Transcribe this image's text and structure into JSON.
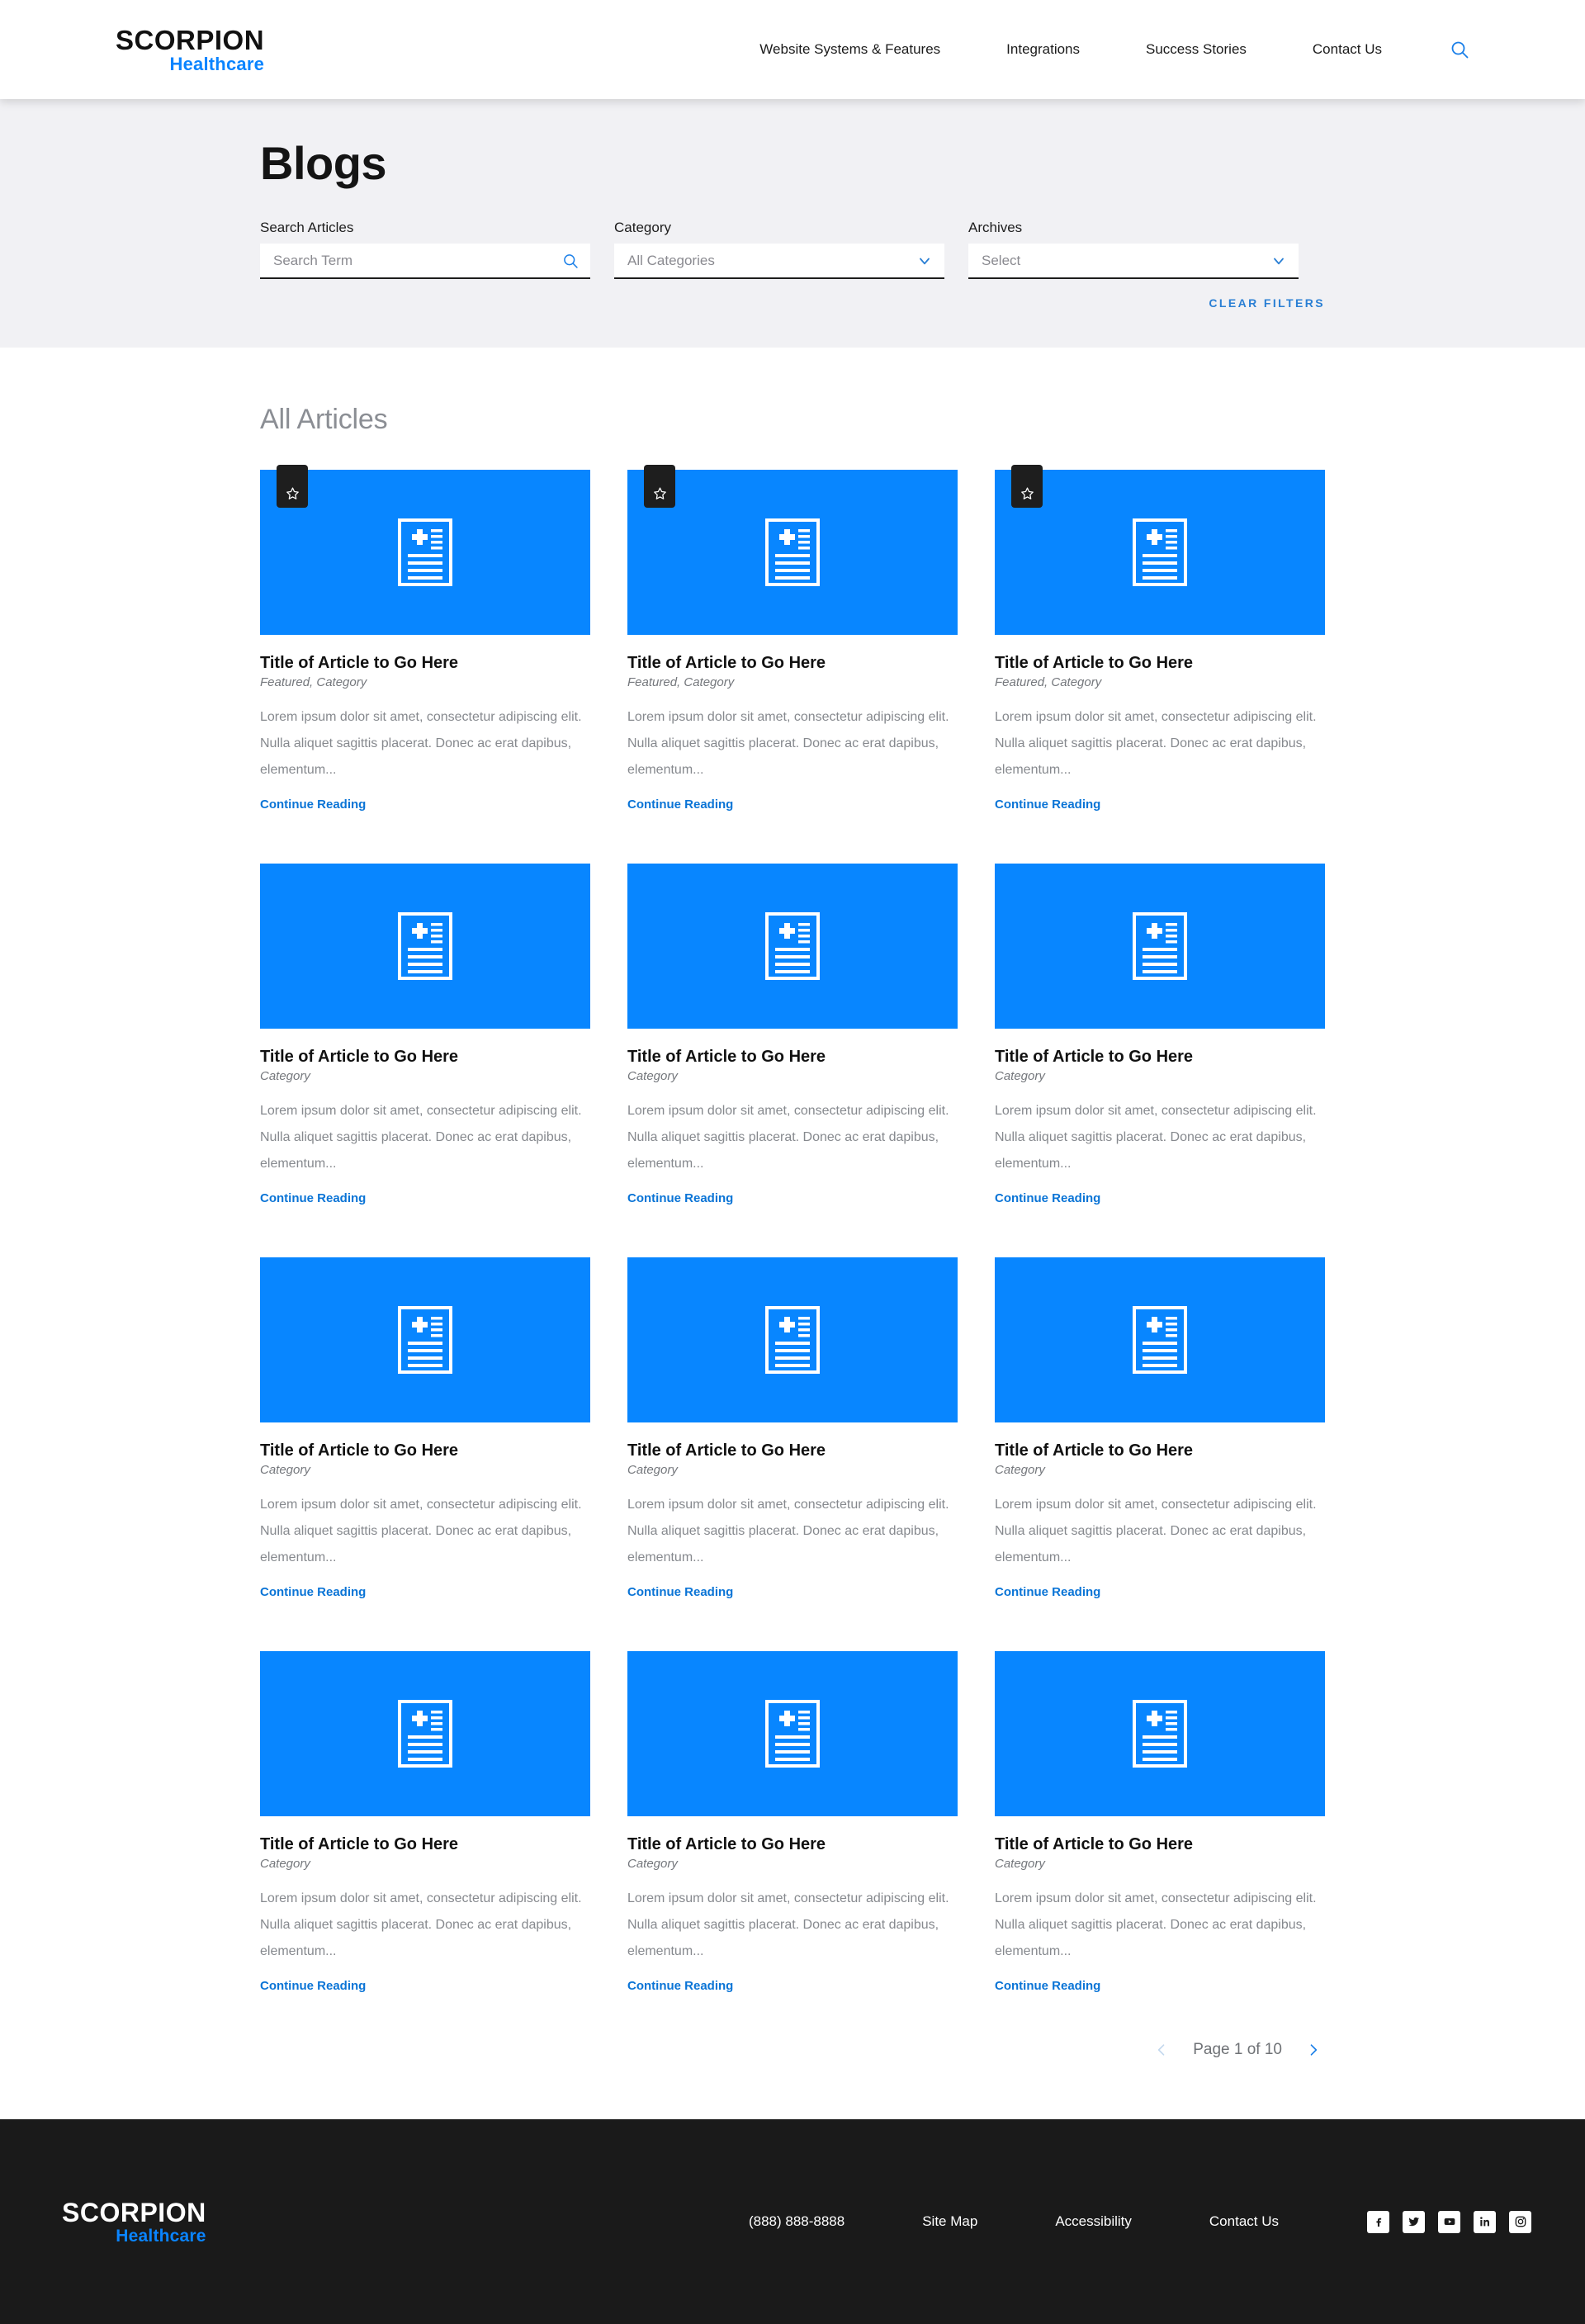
{
  "header": {
    "logo_top": "SCORPION",
    "logo_sub": "Healthcare",
    "nav": [
      {
        "label": "Website Systems & Features"
      },
      {
        "label": "Integrations"
      },
      {
        "label": "Success Stories"
      },
      {
        "label": "Contact Us"
      }
    ],
    "search_icon": "search-icon"
  },
  "hero": {
    "title": "Blogs",
    "search": {
      "label": "Search Articles",
      "placeholder": "Search Term",
      "value": "",
      "icon": "search-icon"
    },
    "category": {
      "label": "Category",
      "selected": "All Categories",
      "icon": "chevron-down-icon"
    },
    "archives": {
      "label": "Archives",
      "selected": "Select",
      "icon": "chevron-down-icon"
    },
    "clear_filters": "CLEAR FILTERS"
  },
  "articles": {
    "heading": "All Articles",
    "link_label": "Continue Reading",
    "excerpt": "Lorem ipsum dolor sit amet, consectetur adipiscing elit. Nulla aliquet sagittis placerat. Donec ac erat dapibus, elementum...",
    "items": [
      {
        "title": "Title of Article to Go Here",
        "meta": "Featured, Category",
        "featured": true
      },
      {
        "title": "Title of Article to Go Here",
        "meta": "Featured, Category",
        "featured": true
      },
      {
        "title": "Title of Article to Go Here",
        "meta": "Featured, Category",
        "featured": true
      },
      {
        "title": "Title of Article to Go Here",
        "meta": "Category",
        "featured": false
      },
      {
        "title": "Title of Article to Go Here",
        "meta": "Category",
        "featured": false
      },
      {
        "title": "Title of Article to Go Here",
        "meta": "Category",
        "featured": false
      },
      {
        "title": "Title of Article to Go Here",
        "meta": "Category",
        "featured": false
      },
      {
        "title": "Title of Article to Go Here",
        "meta": "Category",
        "featured": false
      },
      {
        "title": "Title of Article to Go Here",
        "meta": "Category",
        "featured": false
      },
      {
        "title": "Title of Article to Go Here",
        "meta": "Category",
        "featured": false
      },
      {
        "title": "Title of Article to Go Here",
        "meta": "Category",
        "featured": false
      },
      {
        "title": "Title of Article to Go Here",
        "meta": "Category",
        "featured": false
      }
    ]
  },
  "pagination": {
    "prev_icon": "chevron-left-icon",
    "next_icon": "chevron-right-icon",
    "label": "Page 1 of 10"
  },
  "footer": {
    "logo_top": "SCORPION",
    "logo_sub": "Healthcare",
    "links": [
      {
        "label": "(888) 888-8888"
      },
      {
        "label": "Site Map"
      },
      {
        "label": "Accessibility"
      },
      {
        "label": "Contact Us"
      }
    ],
    "social": [
      {
        "name": "facebook-icon"
      },
      {
        "name": "twitter-icon"
      },
      {
        "name": "youtube-icon"
      },
      {
        "name": "linkedin-icon"
      },
      {
        "name": "instagram-icon"
      }
    ]
  },
  "colors": {
    "brand_blue": "#0886ff",
    "link_blue": "#0a74d6",
    "hero_bg": "#f1f1f4",
    "footer_bg": "#1a1a1a",
    "badge_bg": "#1e1e1e"
  }
}
